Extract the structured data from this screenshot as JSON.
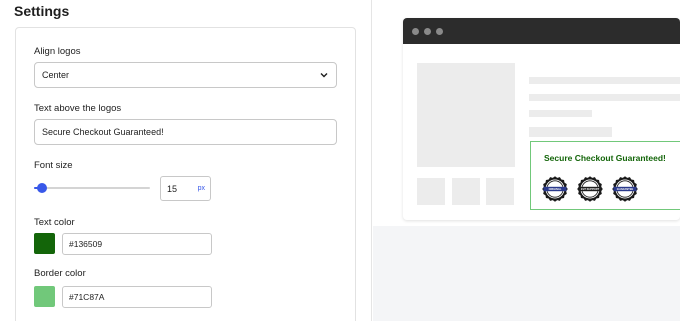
{
  "settings": {
    "title": "Settings",
    "align_logos": {
      "label": "Align logos",
      "value": "Center"
    },
    "text_above": {
      "label": "Text above the logos",
      "value": "Secure Checkout Guaranteed!"
    },
    "font_size": {
      "label": "Font size",
      "value": "15",
      "unit": "px",
      "slider_fraction": 0.07
    },
    "text_color": {
      "label": "Text color",
      "value": "#136509",
      "swatch": "#136509"
    },
    "border_color": {
      "label": "Border color",
      "value": "#71C87A",
      "swatch": "#71C87A"
    }
  },
  "preview": {
    "badge_title": "Secure Checkout Guaranteed!",
    "title_color": "#136509",
    "border_color": "#71C87A",
    "seals": [
      {
        "name": "original-seal",
        "text": "ORIGINAL",
        "color": "#2b3a8c"
      },
      {
        "name": "24-7-support-seal",
        "text": "24/7 SUPPORT",
        "color": "#1e1e1e"
      },
      {
        "name": "guarantee-seal",
        "text": "GUARANTEE",
        "color": "#2b3a8c"
      }
    ]
  }
}
